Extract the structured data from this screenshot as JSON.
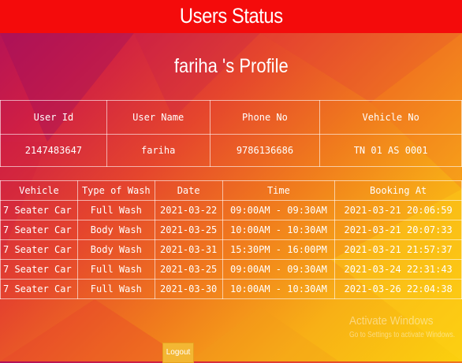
{
  "header": {
    "title": "Users Status"
  },
  "profile": {
    "heading": "fariha 's Profile"
  },
  "user_table": {
    "columns": [
      "User Id",
      "User Name",
      "Phone No",
      "Vehicle No"
    ],
    "row": {
      "user_id": "2147483647",
      "user_name": "fariha",
      "phone_no": "9786136686",
      "vehicle_no": "TN 01 AS 0001"
    }
  },
  "booking_table": {
    "columns": [
      "Vehicle",
      "Type of Wash",
      "Date",
      "Time",
      "Booking At"
    ],
    "rows": [
      {
        "vehicle": "7 Seater Car",
        "wash": "Full Wash",
        "date": "2021-03-22",
        "time": "09:00AM - 09:30AM",
        "booked": "2021-03-21 20:06:59"
      },
      {
        "vehicle": "7 Seater Car",
        "wash": "Body Wash",
        "date": "2021-03-25",
        "time": "10:00AM - 10:30AM",
        "booked": "2021-03-21 20:07:33"
      },
      {
        "vehicle": "7 Seater Car",
        "wash": "Body Wash",
        "date": "2021-03-31",
        "time": "15:30PM - 16:00PM",
        "booked": "2021-03-21 21:57:37"
      },
      {
        "vehicle": "7 Seater Car",
        "wash": "Full Wash",
        "date": "2021-03-25",
        "time": "09:00AM - 09:30AM",
        "booked": "2021-03-24 22:31:43"
      },
      {
        "vehicle": "7 Seater Car",
        "wash": "Full Wash",
        "date": "2021-03-30",
        "time": "10:00AM - 10:30AM",
        "booked": "2021-03-26 22:04:38"
      }
    ]
  },
  "actions": {
    "logout_label": "Logout"
  },
  "watermark": {
    "title": "Activate Windows",
    "subtitle": "Go to Settings to activate Windows."
  },
  "colors": {
    "header_bar": "#f40b0b",
    "background_start": "#b0105a",
    "background_end": "#fbd00e",
    "logout_button": "#f3b733"
  }
}
